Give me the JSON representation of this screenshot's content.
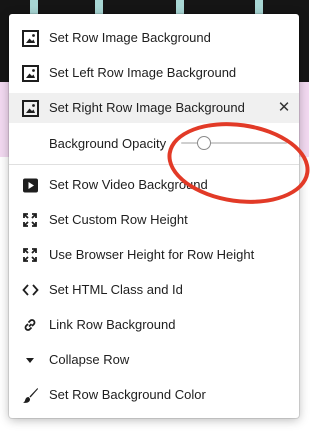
{
  "menu": {
    "items": [
      {
        "label": "Set Row Image Background",
        "icon": "image-icon"
      },
      {
        "label": "Set Left Row Image Background",
        "icon": "image-icon"
      },
      {
        "label": "Set Right Row Image Background",
        "icon": "image-icon",
        "active": true
      }
    ],
    "close_symbol": "✕",
    "opacity": {
      "label": "Background Opacity",
      "value": 0.2
    },
    "items2": [
      {
        "label": "Set Row Video Background",
        "icon": "video-play-icon"
      },
      {
        "label": "Set Custom Row Height",
        "icon": "resize-arrows-icon"
      },
      {
        "label": "Use Browser Height for Row Height",
        "icon": "resize-arrows-icon"
      },
      {
        "label": "Set HTML Class and Id",
        "icon": "code-brackets-icon"
      },
      {
        "label": "Link Row Background",
        "icon": "link-icon"
      },
      {
        "label": "Collapse Row",
        "icon": "triangle-down-icon"
      },
      {
        "label": "Set Row Background Color",
        "icon": "paintbrush-icon"
      }
    ]
  },
  "colors": {
    "annotation": "#e23a27",
    "highlight": "#f0f0f0",
    "page_pink": "#f2d9f1",
    "page_dark": "#151515"
  }
}
